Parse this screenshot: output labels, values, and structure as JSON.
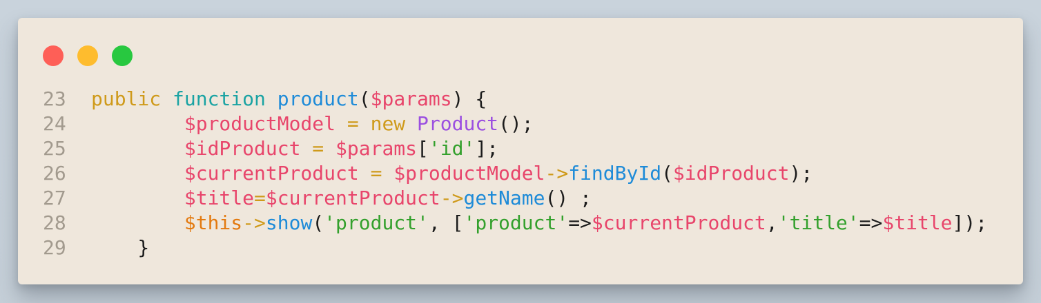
{
  "window": {
    "controls": [
      {
        "name": "close",
        "color": "#fe5f57"
      },
      {
        "name": "minimize",
        "color": "#febc2e"
      },
      {
        "name": "maximize",
        "color": "#28c840"
      }
    ]
  },
  "code": {
    "lines": [
      {
        "number": "23",
        "tokens": [
          {
            "t": "kw",
            "v": "public"
          },
          {
            "t": "pl",
            "v": " "
          },
          {
            "t": "fn",
            "v": "function"
          },
          {
            "t": "pl",
            "v": " "
          },
          {
            "t": "name",
            "v": "product"
          },
          {
            "t": "pl",
            "v": "("
          },
          {
            "t": "var",
            "v": "$params"
          },
          {
            "t": "pl",
            "v": ") {"
          }
        ]
      },
      {
        "number": "24",
        "tokens": [
          {
            "t": "pl",
            "v": "        "
          },
          {
            "t": "var",
            "v": "$productModel"
          },
          {
            "t": "pl",
            "v": " "
          },
          {
            "t": "op",
            "v": "="
          },
          {
            "t": "pl",
            "v": " "
          },
          {
            "t": "kw",
            "v": "new"
          },
          {
            "t": "pl",
            "v": " "
          },
          {
            "t": "cls",
            "v": "Product"
          },
          {
            "t": "pl",
            "v": "();"
          }
        ]
      },
      {
        "number": "25",
        "tokens": [
          {
            "t": "pl",
            "v": "        "
          },
          {
            "t": "var",
            "v": "$idProduct"
          },
          {
            "t": "pl",
            "v": " "
          },
          {
            "t": "op",
            "v": "="
          },
          {
            "t": "pl",
            "v": " "
          },
          {
            "t": "var",
            "v": "$params"
          },
          {
            "t": "pl",
            "v": "["
          },
          {
            "t": "str",
            "v": "'id'"
          },
          {
            "t": "pl",
            "v": "];"
          }
        ]
      },
      {
        "number": "26",
        "tokens": [
          {
            "t": "pl",
            "v": "        "
          },
          {
            "t": "var",
            "v": "$currentProduct"
          },
          {
            "t": "pl",
            "v": " "
          },
          {
            "t": "op",
            "v": "="
          },
          {
            "t": "pl",
            "v": " "
          },
          {
            "t": "var",
            "v": "$productModel"
          },
          {
            "t": "op",
            "v": "->"
          },
          {
            "t": "name",
            "v": "findById"
          },
          {
            "t": "pl",
            "v": "("
          },
          {
            "t": "var",
            "v": "$idProduct"
          },
          {
            "t": "pl",
            "v": ");"
          }
        ]
      },
      {
        "number": "27",
        "tokens": [
          {
            "t": "pl",
            "v": "        "
          },
          {
            "t": "var",
            "v": "$title"
          },
          {
            "t": "op",
            "v": "="
          },
          {
            "t": "var",
            "v": "$currentProduct"
          },
          {
            "t": "op",
            "v": "->"
          },
          {
            "t": "name",
            "v": "getName"
          },
          {
            "t": "pl",
            "v": "() ;"
          }
        ]
      },
      {
        "number": "28",
        "tokens": [
          {
            "t": "pl",
            "v": "        "
          },
          {
            "t": "this",
            "v": "$this"
          },
          {
            "t": "op",
            "v": "->"
          },
          {
            "t": "name",
            "v": "show"
          },
          {
            "t": "pl",
            "v": "("
          },
          {
            "t": "str",
            "v": "'product'"
          },
          {
            "t": "pl",
            "v": ", ["
          },
          {
            "t": "str",
            "v": "'product'"
          },
          {
            "t": "pl",
            "v": "=>"
          },
          {
            "t": "var",
            "v": "$currentProduct"
          },
          {
            "t": "pl",
            "v": ","
          },
          {
            "t": "str",
            "v": "'title'"
          },
          {
            "t": "pl",
            "v": "=>"
          },
          {
            "t": "var",
            "v": "$title"
          },
          {
            "t": "pl",
            "v": "]);"
          }
        ]
      },
      {
        "number": "29",
        "tokens": [
          {
            "t": "pl",
            "v": "    }"
          }
        ]
      }
    ]
  }
}
